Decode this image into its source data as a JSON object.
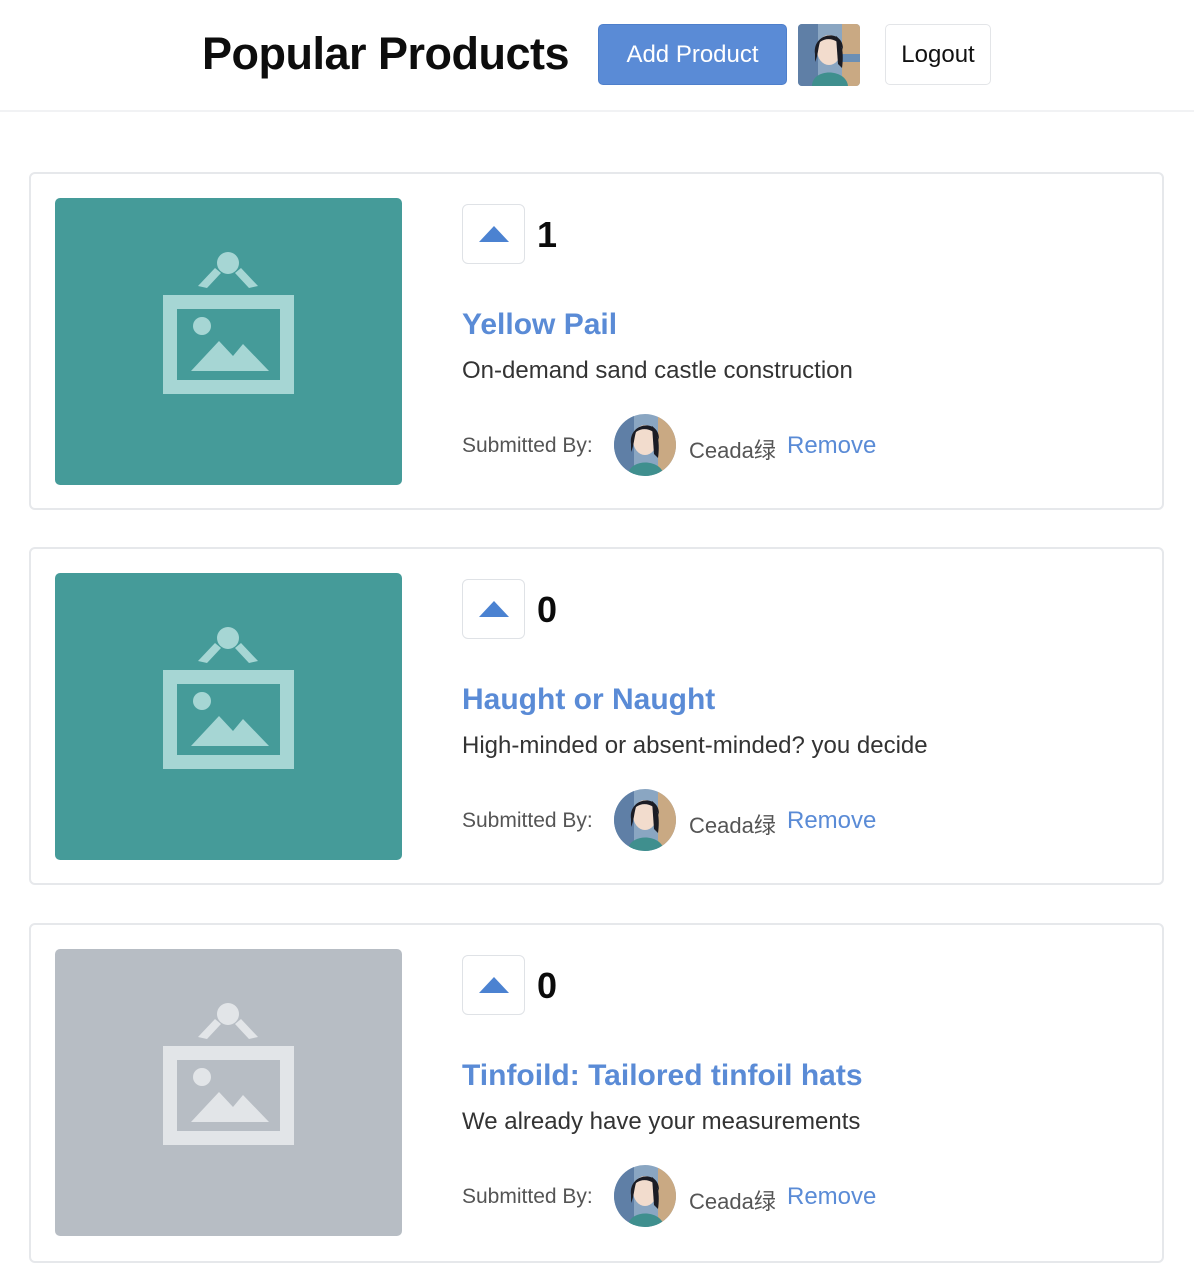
{
  "header": {
    "title": "Popular Products",
    "add_label": "Add Product",
    "logout_label": "Logout",
    "avatar_icon": "user-avatar"
  },
  "submitted_by_label": "Submitted By:",
  "products": [
    {
      "votes": "1",
      "title": "Yellow Pail",
      "description": "On-demand sand castle construction",
      "author": "Ceada绿",
      "remove_label": "Remove",
      "thumbnail_color": "#459b99",
      "thumbnail_icon_color": "#a6d6d4"
    },
    {
      "votes": "0",
      "title": "Haught or Naught",
      "description": "High-minded or absent-minded? you decide",
      "author": "Ceada绿",
      "remove_label": "Remove",
      "thumbnail_color": "#459b99",
      "thumbnail_icon_color": "#a6d6d4"
    },
    {
      "votes": "0",
      "title": "Tinfoild: Tailored tinfoil hats",
      "description": "We already have your measurements",
      "author": "Ceada绿",
      "remove_label": "Remove",
      "thumbnail_color": "#b7bdc4",
      "thumbnail_icon_color": "#e2e5e8"
    }
  ],
  "colors": {
    "accent": "#5a8bd6",
    "upvote_arrow": "#4b82d1"
  }
}
